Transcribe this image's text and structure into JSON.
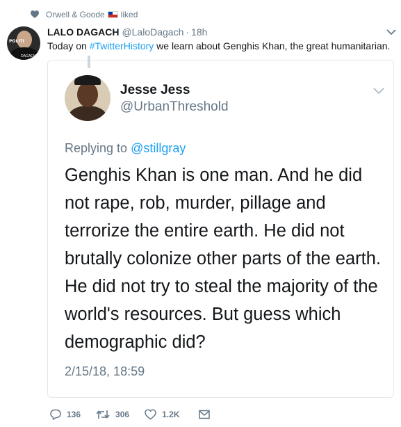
{
  "social_context": {
    "actor": "Orwell & Goode",
    "action": "liked"
  },
  "tweet": {
    "author_name": "LALO DAGACH",
    "author_handle": "@LaloDagach",
    "separator": "·",
    "time": "18h",
    "text_before": "Today on ",
    "hashtag": "#TwitterHistory",
    "text_after": " we learn about Genghis Khan, the great humanitarian.",
    "avatar_text": "POLITI",
    "avatar_subtext": "DAGACH"
  },
  "quoted": {
    "author_name": "Jesse Jess",
    "author_handle": "@UrbanThreshold",
    "replying_to_label": "Replying to",
    "replying_to_handle": "@stillgray",
    "body_lines": [
      "Genghis Khan is one man. And he did",
      "not rape, rob, murder, pillage and",
      "terrorize the entire earth. He did not",
      "brutally colonize other parts of the earth.",
      "He did not try to steal the majority of the",
      "world's resources. But guess which",
      "demographic did?"
    ],
    "date": "2/15/18, 18:59"
  },
  "actions": {
    "replies": "136",
    "retweets": "306",
    "likes": "1.2K"
  },
  "colors": {
    "link": "#1da1f2",
    "secondary_text": "#657786",
    "border": "#e1e8ed"
  },
  "icons": {
    "social_context": "heart-icon",
    "reply": "reply-icon",
    "retweet": "retweet-icon",
    "like": "heart-icon",
    "dm": "envelope-icon",
    "caret": "chevron-down-icon"
  }
}
